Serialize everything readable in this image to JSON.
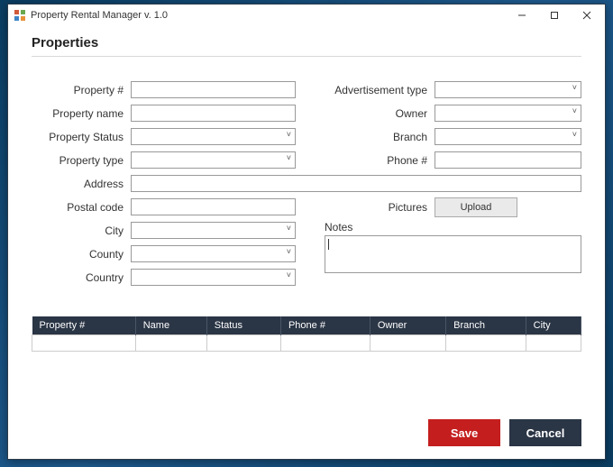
{
  "window": {
    "title": "Property Rental Manager v. 1.0"
  },
  "page": {
    "title": "Properties"
  },
  "form": {
    "left": {
      "property_number": {
        "label": "Property #",
        "value": ""
      },
      "property_name": {
        "label": "Property name",
        "value": ""
      },
      "property_status": {
        "label": "Property Status",
        "value": ""
      },
      "property_type": {
        "label": "Property type",
        "value": ""
      },
      "address": {
        "label": "Address",
        "value": ""
      },
      "postal_code": {
        "label": "Postal code",
        "value": ""
      },
      "city": {
        "label": "City",
        "value": ""
      },
      "county": {
        "label": "County",
        "value": ""
      },
      "country": {
        "label": "Country",
        "value": ""
      }
    },
    "right": {
      "ad_type": {
        "label": "Advertisement type",
        "value": ""
      },
      "owner": {
        "label": "Owner",
        "value": ""
      },
      "branch": {
        "label": "Branch",
        "value": ""
      },
      "phone": {
        "label": "Phone #",
        "value": ""
      },
      "pictures": {
        "label": "Pictures",
        "button": "Upload"
      },
      "notes": {
        "label": "Notes",
        "value": ""
      }
    }
  },
  "table": {
    "columns": [
      "Property #",
      "Name",
      "Status",
      "Phone #",
      "Owner",
      "Branch",
      "City"
    ],
    "rows": [
      [
        "",
        "",
        "",
        "",
        "",
        "",
        ""
      ]
    ]
  },
  "footer": {
    "save": "Save",
    "cancel": "Cancel"
  }
}
